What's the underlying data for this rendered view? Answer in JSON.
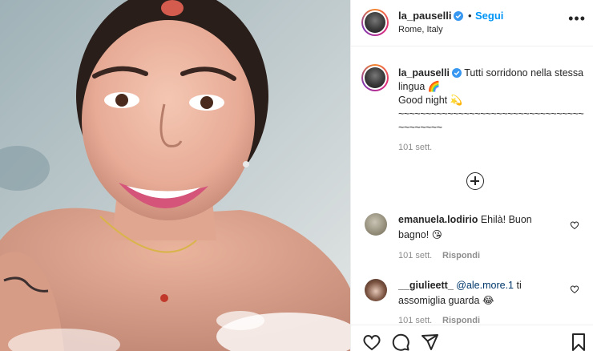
{
  "post": {
    "username": "la_pauselli",
    "verified": true,
    "follow_label": "Segui",
    "location": "Rome, Italy",
    "more_label": "•••"
  },
  "caption": {
    "username": "la_pauselli",
    "text_line1": "Tutti sorridono nella stessa lingua",
    "emoji1": "🌈",
    "text_line2": "Good night",
    "emoji2": "💫",
    "tildes": "~~~~~~~~~~~~~~~~~~~~~~~~~~~~~~~~~~~~~~~~~~",
    "time": "101 sett."
  },
  "comments": [
    {
      "username": "emanuela.lodirio",
      "text": "Ehilà! Buon bagno!",
      "emoji": "😘",
      "time": "101 sett.",
      "reply_label": "Rispondi"
    },
    {
      "username": "__giulieett_",
      "mention": "@ale.more.1",
      "text": "ti assomiglia guarda",
      "emoji": "😂",
      "time": "101 sett.",
      "reply_label": "Rispondi"
    }
  ],
  "actions": {
    "icons": [
      "heart-icon",
      "comment-icon",
      "share-icon",
      "bookmark-icon"
    ]
  },
  "colors": {
    "link_blue": "#0095f6",
    "verified_blue": "#3897f0",
    "muted": "#8e8e8e",
    "text": "#262626"
  }
}
